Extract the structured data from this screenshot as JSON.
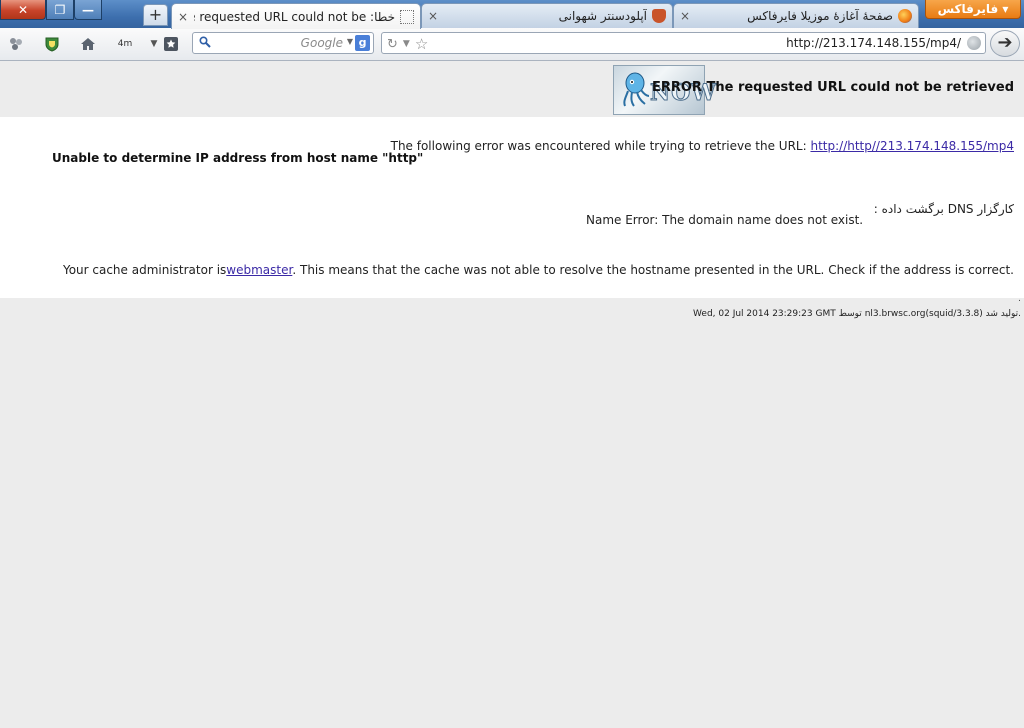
{
  "browser": {
    "window_buttons": {
      "close": "✕",
      "maximize": "❐",
      "minimize": "—"
    },
    "firefox_menu_label": "فایرفاکس ▾",
    "new_tab_label": "+",
    "tabs": [
      {
        "title": "صفحهٔ آغازهٔ موزیلا فایرفاکس",
        "icon": "firefox-icon",
        "close": "×"
      },
      {
        "title": "آپلودسنتر شهوانی",
        "icon": "shield-icon",
        "close": "×"
      },
      {
        "title": "خطا: The requested URL could not be ...",
        "icon": "loading-icon",
        "close": "×",
        "active": true
      }
    ],
    "search": {
      "placeholder": "Google",
      "engine_badge": "g"
    },
    "url": "http://213.174.148.155/mp4/",
    "go_label": "➔",
    "toolbar_icons": [
      "addons-icon",
      "shield-icon",
      "home-icon",
      "bookmarks-dropdown-icon",
      "bookmark-star-icon"
    ],
    "toolbar_small_text": "4m"
  },
  "page": {
    "logo_text": "NOW",
    "title": "ERROR The requested URL could not be retrieved",
    "error_intro": "The following error was encountered while trying to retrieve the URL:",
    "error_url": "http://http//213.174.148.155/mp4",
    "error_heading": "Unable to determine IP address from host name \"http\"",
    "dns_label": "کارگزار DNS برگشت داده :",
    "dns_error": "Name Error: The domain name does not exist.",
    "explain_prefix": "This means that the cache was not able to resolve the hostname presented in the URL. Check if the address is correct.",
    "admin_prefix": "Your cache administrator is",
    "admin_link": "webmaster",
    "admin_suffix": ".",
    "footer": "Wed, 02 Jul 2014 23:29:23 GMT توسط nl3.brwsc.org(squid/3.3.8) تولید شد.",
    "footer_mark": "."
  },
  "colors": {
    "tabstrip": "#4a7ab7",
    "firefox_button": "#e87b13",
    "link": "#3b2aa6",
    "page_bg": "#ececec"
  }
}
